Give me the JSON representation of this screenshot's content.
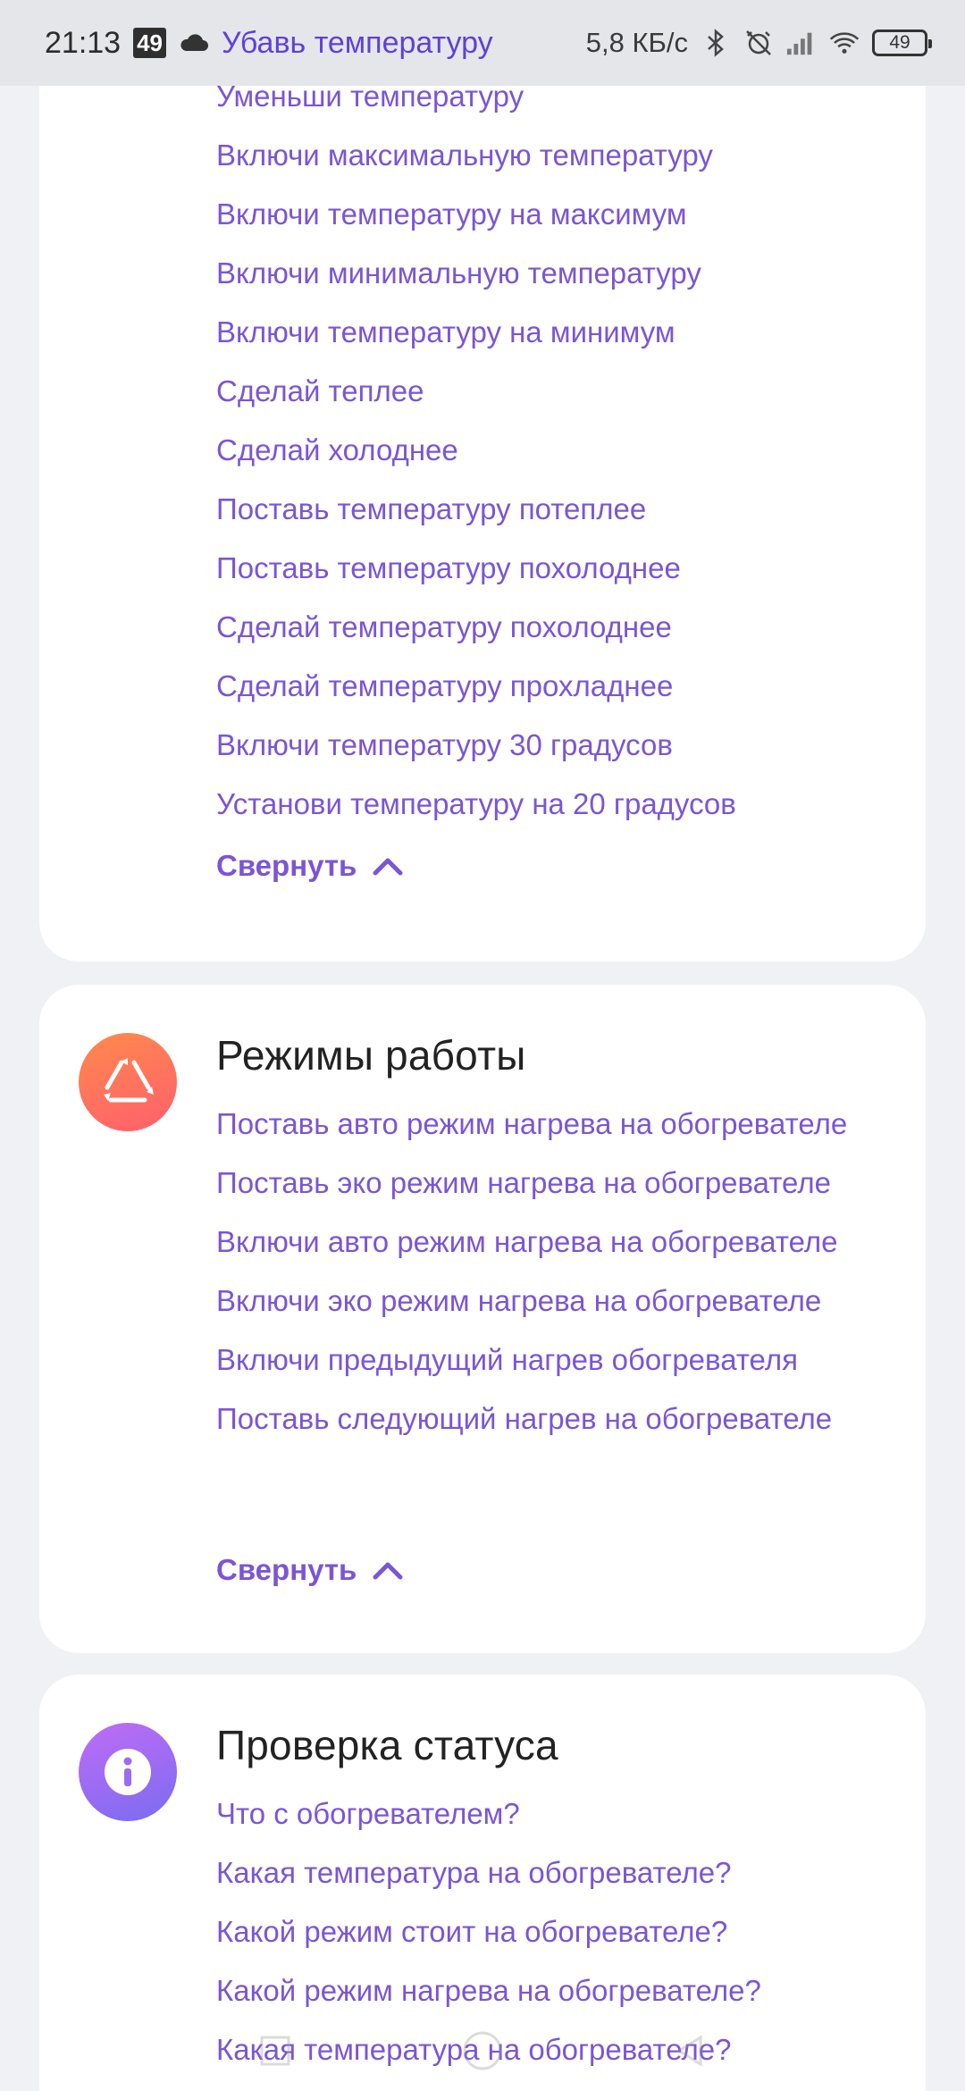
{
  "status_bar": {
    "time": "21:13",
    "badge": "49",
    "notification_text": "Убавь температуру",
    "network_speed": "5,8 КБ/с",
    "battery_level": "49"
  },
  "cards": {
    "temperature": {
      "commands": [
        "Уменьши температуру",
        "Включи максимальную температуру",
        "Включи температуру на максимум",
        "Включи минимальную температуру",
        "Включи температуру на минимум",
        "Сделай теплее",
        "Сделай холоднее",
        "Поставь температуру потеплее",
        "Поставь температуру похолоднее",
        "Сделай температуру похолоднее",
        "Сделай температуру прохладнее",
        "Включи температуру 30 градусов",
        "Установи температуру на 20 градусов"
      ],
      "collapse_label": "Свернуть"
    },
    "modes": {
      "title": "Режимы работы",
      "icon": "recycle-triangle-icon",
      "icon_color": "#ff6f5e",
      "commands": [
        "Поставь авто режим нагрева на обогревателе",
        "Поставь эко режим нагрева на обогревателе",
        "Включи авто режим нагрева на обогревателе",
        "Включи эко режим нагрева на обогревателе",
        "Включи предыдущий нагрев обогревателя",
        "Поставь следующий нагрев на обогревателе"
      ],
      "collapse_label": "Свернуть"
    },
    "status": {
      "title": "Проверка статуса",
      "icon": "info-icon",
      "icon_color": "#9a6cf2",
      "commands": [
        "Что с обогревателем?",
        "Какая температура на обогревателе?",
        "Какой режим стоит на обогревателе?",
        "Какой режим нагрева на обогревателе?",
        "Какая температура на обогревателе?"
      ]
    }
  },
  "colors": {
    "accent": "#7b55d6",
    "background": "#f0f1f4",
    "card": "#ffffff"
  }
}
